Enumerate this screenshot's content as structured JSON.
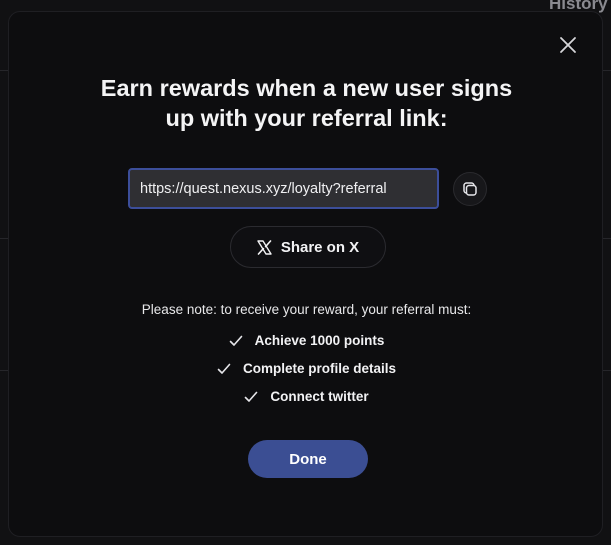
{
  "background": {
    "history_label": "History"
  },
  "modal": {
    "title_line1": "Earn rewards when a new user signs",
    "title_line2": "up with your referral link:",
    "referral_link": "https://quest.nexus.xyz/loyalty?referral",
    "share_label": "Share on X",
    "note": "Please note: to receive your reward, your referral must:",
    "requirements": [
      "Achieve 1000 points",
      "Complete profile details",
      "Connect twitter"
    ],
    "done_label": "Done"
  },
  "icons": {
    "close": "close-icon",
    "copy": "copy-icon",
    "x_logo": "x-logo-icon",
    "check": "check-icon"
  },
  "colors": {
    "accent": "#3b4e93",
    "input_border": "#3c4e9a",
    "modal_bg": "#0d0d0f"
  }
}
